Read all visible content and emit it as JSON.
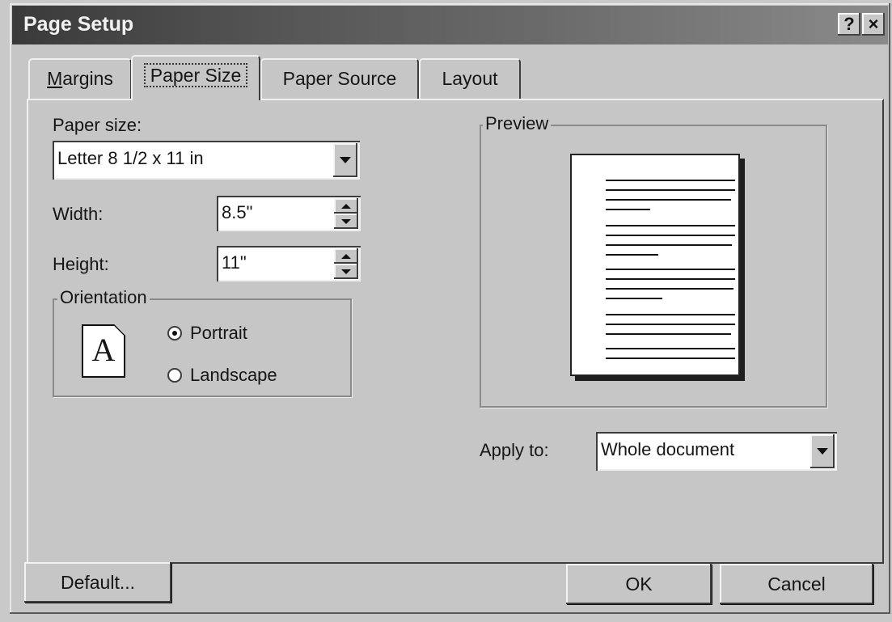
{
  "window": {
    "title": "Page Setup",
    "help_label": "?",
    "close_label": "×"
  },
  "tabs": [
    {
      "label": "Margins",
      "active": false
    },
    {
      "label": "Paper Size",
      "active": true
    },
    {
      "label": "Paper Source",
      "active": false
    },
    {
      "label": "Layout",
      "active": false
    }
  ],
  "paper_size": {
    "label": "Paper size:",
    "value": "Letter 8 1/2 x 11 in"
  },
  "width": {
    "label": "Width:",
    "value": "8.5\""
  },
  "height": {
    "label": "Height:",
    "value": "11\""
  },
  "orientation": {
    "title": "Orientation",
    "icon_letter": "A",
    "portrait_label": "Portrait",
    "landscape_label": "Landscape",
    "selected": "portrait"
  },
  "preview": {
    "title": "Preview"
  },
  "apply_to": {
    "label": "Apply to:",
    "value": "Whole document"
  },
  "buttons": {
    "default_label": "Default...",
    "ok_label": "OK",
    "cancel_label": "Cancel"
  }
}
